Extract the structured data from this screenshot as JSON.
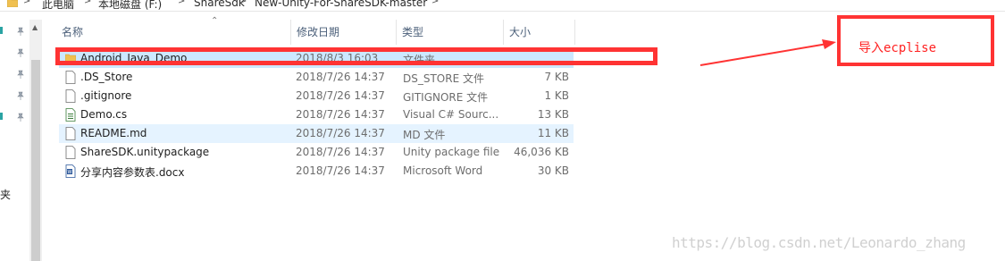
{
  "breadcrumb": {
    "items": [
      "此电脑",
      "本地磁盘 (F:)",
      "ShareSdk",
      "New-Unity-For-ShareSDK-master"
    ],
    "separator": ">"
  },
  "nav": {
    "truncated_label": "夹"
  },
  "columns": {
    "name": "名称",
    "date": "修改日期",
    "type": "类型",
    "size": "大小"
  },
  "files": [
    {
      "name": "Android_Java_Demo",
      "date": "2018/8/3 16:03",
      "type": "文件夹",
      "size": "",
      "icon": "folder-icon"
    },
    {
      "name": ".DS_Store",
      "date": "2018/7/26 14:37",
      "type": "DS_STORE 文件",
      "size": "7 KB",
      "icon": "file-icon"
    },
    {
      "name": ".gitignore",
      "date": "2018/7/26 14:37",
      "type": "GITIGNORE 文件",
      "size": "1 KB",
      "icon": "file-icon"
    },
    {
      "name": "Demo.cs",
      "date": "2018/7/26 14:37",
      "type": "Visual C# Sourc...",
      "size": "13 KB",
      "icon": "csharp-file-icon"
    },
    {
      "name": "README.md",
      "date": "2018/7/26 14:37",
      "type": "MD 文件",
      "size": "11 KB",
      "icon": "file-icon"
    },
    {
      "name": "ShareSDK.unitypackage",
      "date": "2018/7/26 14:37",
      "type": "Unity package file",
      "size": "46,036 KB",
      "icon": "file-icon"
    },
    {
      "name": "分享内容参数表.docx",
      "date": "2018/7/26 14:37",
      "type": "Microsoft Word",
      "size": "30 KB",
      "icon": "word-file-icon"
    }
  ],
  "annotation": {
    "callout_text": "导入ecplise"
  },
  "watermark": "https://blog.csdn.net/Leonardo_zhang",
  "colors": {
    "selection": "#cce8ff",
    "hover": "#e5f3ff",
    "annotation_red": "#ff3333",
    "folder": "#f0c050"
  }
}
